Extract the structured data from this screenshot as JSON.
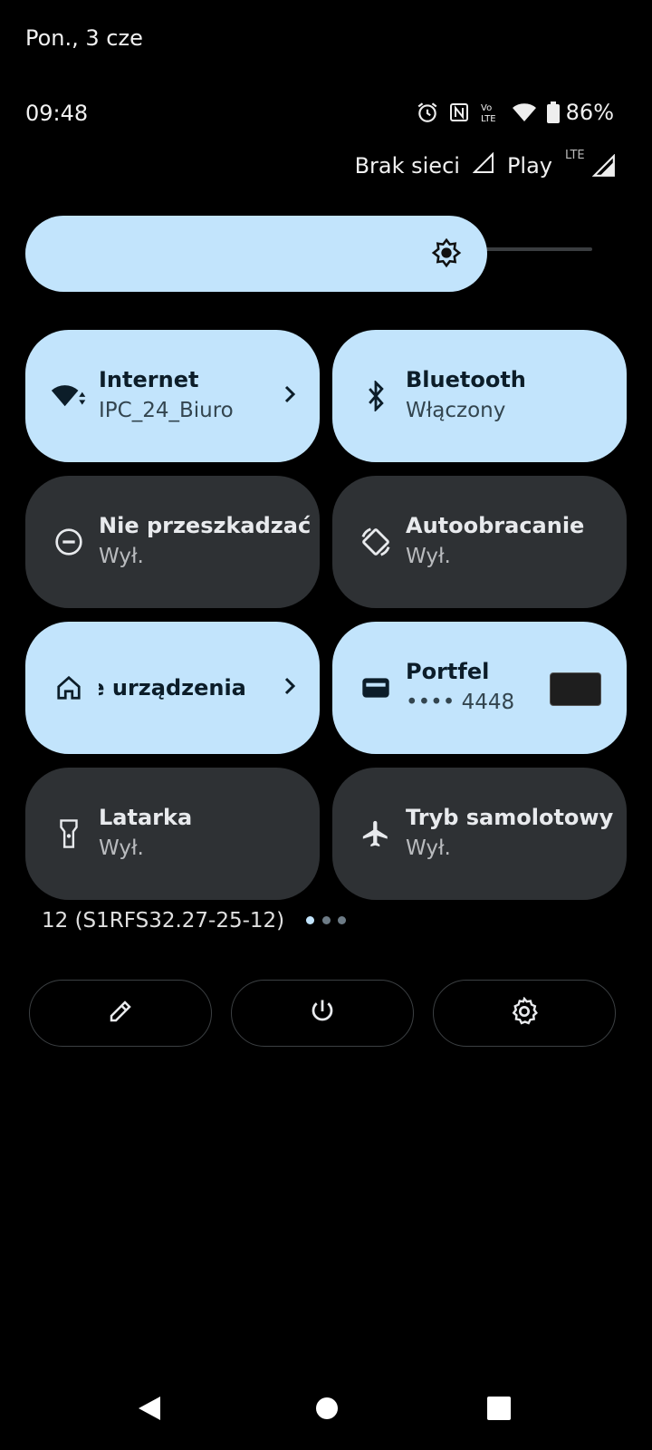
{
  "status_bar": {
    "date": "Pon., 3 cze",
    "time": "09:48",
    "battery_percent": "86%",
    "icons": [
      "alarm-icon",
      "nfc-icon",
      "volte-icon",
      "wifi-icon",
      "battery-icon"
    ]
  },
  "carrier": {
    "sim1": "Brak sieci",
    "sim2": "Play",
    "sim2_network": "LTE"
  },
  "brightness": {
    "level": 0.79
  },
  "tiles": [
    {
      "title": "Internet",
      "subtitle": "IPC_24_Biuro",
      "state": "on",
      "icon": "wifi-icon"
    },
    {
      "title": "Bluetooth",
      "subtitle": "Włączony",
      "state": "on",
      "icon": "bluetooth-icon"
    },
    {
      "title": "Nie przeszkadzać",
      "subtitle": "Wył.",
      "state": "off",
      "icon": "do-not-disturb-icon"
    },
    {
      "title": "Autoobracanie",
      "subtitle": "Wył.",
      "state": "off",
      "icon": "auto-rotate-icon"
    },
    {
      "title": "ie urządzenia",
      "state": "on",
      "icon": "home-icon"
    },
    {
      "title": "Portfel",
      "subtitle": "•••• 4448",
      "state": "on",
      "icon": "wallet-icon"
    },
    {
      "title": "Latarka",
      "subtitle": "Wył.",
      "state": "off",
      "icon": "flashlight-icon"
    },
    {
      "title": "Tryb samolotowy",
      "subtitle": "Wył.",
      "state": "off",
      "icon": "airplane-icon"
    }
  ],
  "footer": {
    "build": "12 (S1RFS32.27-25-12)",
    "page_dots": 3,
    "active_page": 1,
    "buttons": [
      "edit-icon",
      "power-icon",
      "settings-icon"
    ]
  },
  "nav_bar": [
    "back-icon",
    "home-icon",
    "recents-icon"
  ],
  "colors": {
    "tile_on": "#c2e4fc",
    "tile_off": "#2e3134",
    "background": "#000000"
  }
}
